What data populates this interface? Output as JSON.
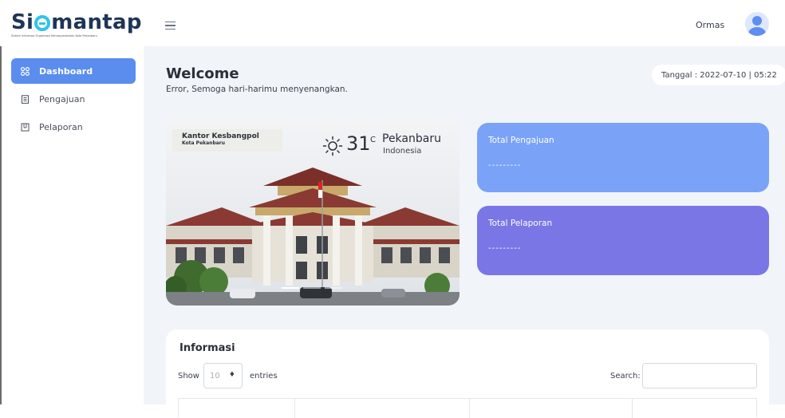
{
  "app": {
    "logo_text_pre": "Si",
    "logo_text_post": "mantap",
    "logo_subtitle": "Sistem Informasi Organisasi Kemasyarakatan Kota Pekanbaru"
  },
  "header": {
    "username": "Ormas"
  },
  "sidebar": {
    "items": [
      {
        "label": "Dashboard",
        "icon": "grid-icon",
        "active": true
      },
      {
        "label": "Pengajuan",
        "icon": "document-icon",
        "active": false
      },
      {
        "label": "Pelaporan",
        "icon": "report-icon",
        "active": false
      }
    ]
  },
  "main": {
    "title": "Welcome",
    "greeting": "Error, Semoga hari-harimu menyenangkan.",
    "date_text": "Tanggal : 2022-07-10 | 05:22",
    "photo": {
      "caption_title": "Kantor Kesbangpol",
      "caption_sub": "Kota Pekanbaru",
      "weather_icon": "sun-icon",
      "temperature": "31",
      "unit": "C",
      "city": "Pekanbaru",
      "country": "Indonesia"
    },
    "cards": [
      {
        "title": "Total Pengajuan",
        "value": "---------",
        "color": "#7aa2f7"
      },
      {
        "title": "Total Pelaporan",
        "value": "---------",
        "color": "#7b76e6"
      }
    ],
    "info": {
      "title": "Informasi",
      "show_label": "Show",
      "entries_value": "10",
      "entries_label": "entries",
      "search_label": "Search:"
    }
  },
  "colors": {
    "accent": "#5b8def",
    "background": "#f1f4f9",
    "card_pengajuan": "#7aa2f7",
    "card_pelaporan": "#7b76e6"
  }
}
